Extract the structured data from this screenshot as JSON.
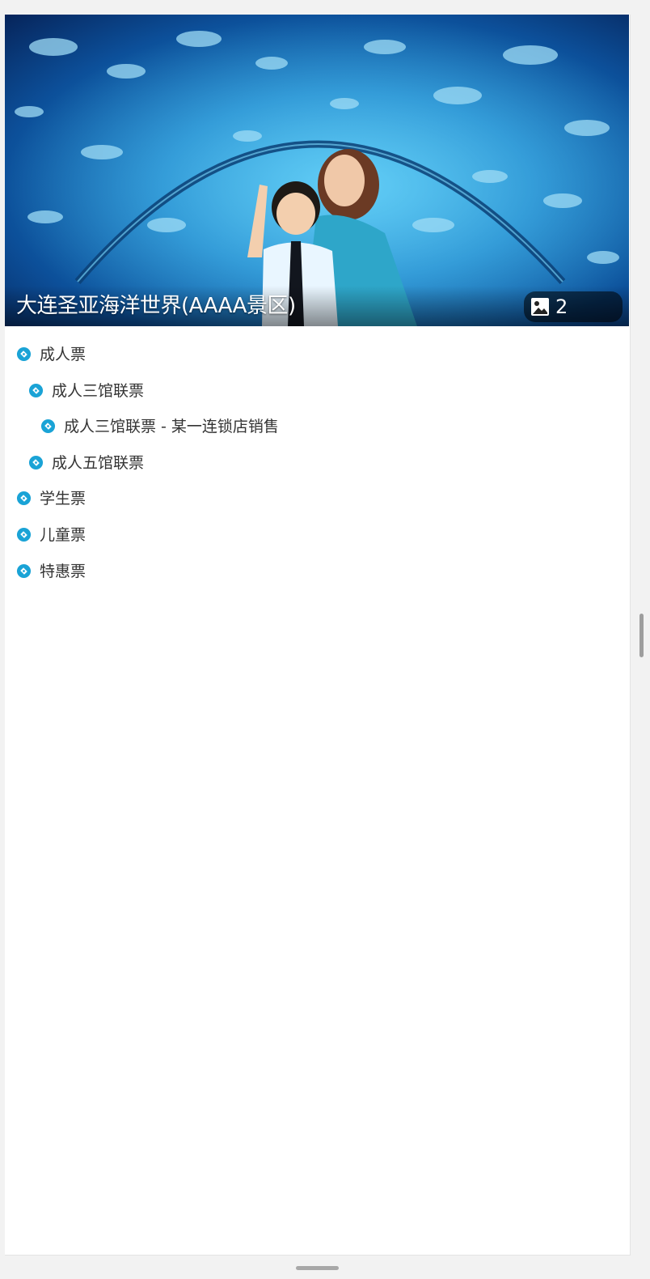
{
  "hero": {
    "title": "大连圣亚海洋世界(AAAA景区)",
    "photo_count": "2",
    "photo_icon": "image-icon"
  },
  "ticket_tree": [
    {
      "label": "成人票",
      "level": 0
    },
    {
      "label": "成人三馆联票",
      "level": 1
    },
    {
      "label": "成人三馆联票 - 某一连锁店销售",
      "level": 2
    },
    {
      "label": "成人五馆联票",
      "level": 1
    },
    {
      "label": "学生票",
      "level": 0
    },
    {
      "label": "儿童票",
      "level": 0
    },
    {
      "label": "特惠票",
      "level": 0
    }
  ],
  "ticket_icon": "ticket-icon",
  "colors": {
    "accent": "#1aa3d6",
    "text": "#333333",
    "background": "#f2f2f2",
    "card": "#ffffff"
  }
}
